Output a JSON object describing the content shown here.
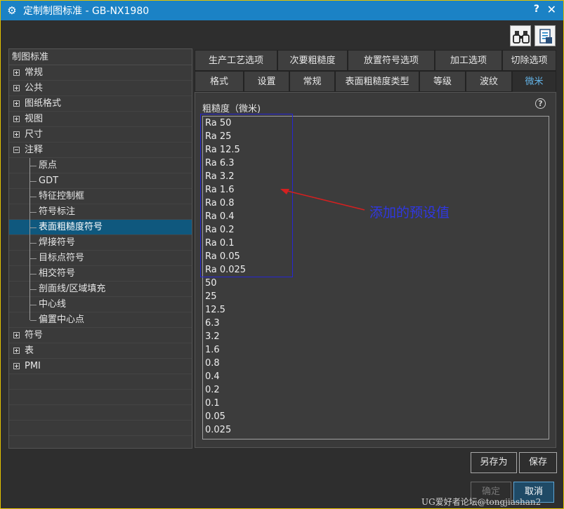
{
  "window": {
    "title": "定制制图标准 - GB-NX1980",
    "help": "?",
    "close": "✕"
  },
  "toolbar": {
    "load_icon": "binoculars-icon",
    "export_icon": "document-icon"
  },
  "tree": {
    "header": "制图标准",
    "items": [
      {
        "label": "常规",
        "level": 1,
        "expander": "plus"
      },
      {
        "label": "公共",
        "level": 1,
        "expander": "plus"
      },
      {
        "label": "图纸格式",
        "level": 1,
        "expander": "plus"
      },
      {
        "label": "视图",
        "level": 1,
        "expander": "plus"
      },
      {
        "label": "尺寸",
        "level": 1,
        "expander": "plus"
      },
      {
        "label": "注释",
        "level": 1,
        "expander": "minus"
      },
      {
        "label": "原点",
        "level": 2
      },
      {
        "label": "GDT",
        "level": 2
      },
      {
        "label": "特征控制框",
        "level": 2
      },
      {
        "label": "符号标注",
        "level": 2
      },
      {
        "label": "表面粗糙度符号",
        "level": 2,
        "selected": true
      },
      {
        "label": "焊接符号",
        "level": 2
      },
      {
        "label": "目标点符号",
        "level": 2
      },
      {
        "label": "相交符号",
        "level": 2
      },
      {
        "label": "剖面线/区域填充",
        "level": 2
      },
      {
        "label": "中心线",
        "level": 2
      },
      {
        "label": "偏置中心点",
        "level": 2,
        "last": true
      },
      {
        "label": "符号",
        "level": 1,
        "expander": "plus"
      },
      {
        "label": "表",
        "level": 1,
        "expander": "plus"
      },
      {
        "label": "PMI",
        "level": 1,
        "expander": "plus"
      }
    ]
  },
  "tabs": {
    "row1": [
      "生产工艺选项",
      "次要粗糙度",
      "放置符号选项",
      "加工选项",
      "切除选项"
    ],
    "row2": [
      "格式",
      "设置",
      "常规",
      "表面粗糙度类型",
      "等级",
      "波纹",
      "微米"
    ],
    "active": "微米"
  },
  "panel": {
    "label": "粗糙度（微米)",
    "help": "?",
    "values": [
      "Ra 50",
      "Ra 25",
      "Ra 12.5",
      "Ra 6.3",
      "Ra 3.2",
      "Ra 1.6",
      "Ra 0.8",
      "Ra 0.4",
      "Ra 0.2",
      "Ra 0.1",
      "Ra 0.05",
      "Ra 0.025",
      "50",
      "25",
      "12.5",
      "6.3",
      "3.2",
      "1.6",
      "0.8",
      "0.4",
      "0.2",
      "0.1",
      "0.05",
      "0.025"
    ]
  },
  "annotation": {
    "text": "添加的预设值",
    "color": "#2f37e3",
    "arrow_color": "#d42020"
  },
  "buttons": {
    "save_as": "另存为",
    "save": "保存",
    "ok": "确定",
    "cancel": "取消"
  },
  "watermark": "UG爱好者论坛@tongjiashan2",
  "colors": {
    "titlebar": "#1b82c5",
    "selection": "#0f587e",
    "active_tab": "#63b4e8",
    "border": "#e3c200"
  }
}
